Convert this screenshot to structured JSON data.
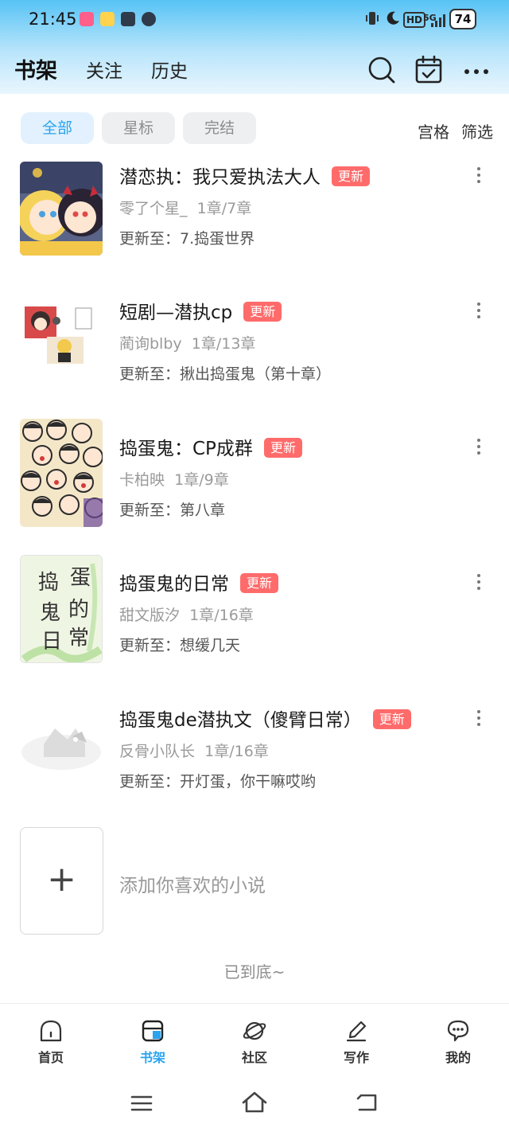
{
  "status": {
    "time": "21:45",
    "network": "5G",
    "hd": "HD",
    "battery": "74"
  },
  "header": {
    "tabs": [
      {
        "label": "书架",
        "active": true
      },
      {
        "label": "关注",
        "active": false
      },
      {
        "label": "历史",
        "active": false
      }
    ]
  },
  "filters": {
    "chips": [
      "全部",
      "星标",
      "完结"
    ],
    "view_mode": "宫格",
    "filter": "筛选"
  },
  "books": [
    {
      "title": "潜恋执：我只爱执法大人",
      "badge": "更新",
      "author": "零了个星_",
      "progress": "1章/7章",
      "update": "更新至：7.捣蛋世界"
    },
    {
      "title": "短剧—潜执cp",
      "badge": "更新",
      "author": "蔺询blby",
      "progress": "1章/13章",
      "update": "更新至：揪出捣蛋鬼（第十章）"
    },
    {
      "title": "捣蛋鬼：CP成群",
      "badge": "更新",
      "author": "卡柏映",
      "progress": "1章/9章",
      "update": "更新至：第八章"
    },
    {
      "title": "捣蛋鬼的日常",
      "badge": "更新",
      "author": "甜文版汐",
      "progress": "1章/16章",
      "update": "更新至：想缓几天"
    },
    {
      "title": "捣蛋鬼de潜执文（傻臂日常）",
      "badge": "更新",
      "author": "反骨小队长",
      "progress": "1章/16章",
      "update": "更新至：开灯蛋，你干嘛哎哟"
    }
  ],
  "add": {
    "plus": "+",
    "label": "添加你喜欢的小说"
  },
  "end_text": "已到底~",
  "cover4_text": [
    "捣",
    "蛋",
    "鬼",
    "的",
    "日",
    "常"
  ],
  "nav": [
    {
      "label": "首页",
      "active": false
    },
    {
      "label": "书架",
      "active": true
    },
    {
      "label": "社区",
      "active": false
    },
    {
      "label": "写作",
      "active": false
    },
    {
      "label": "我的",
      "active": false
    }
  ],
  "colors": {
    "accent": "#2aa4ef",
    "badge": "#ff6b6b",
    "header_top": "#57c3f5"
  }
}
